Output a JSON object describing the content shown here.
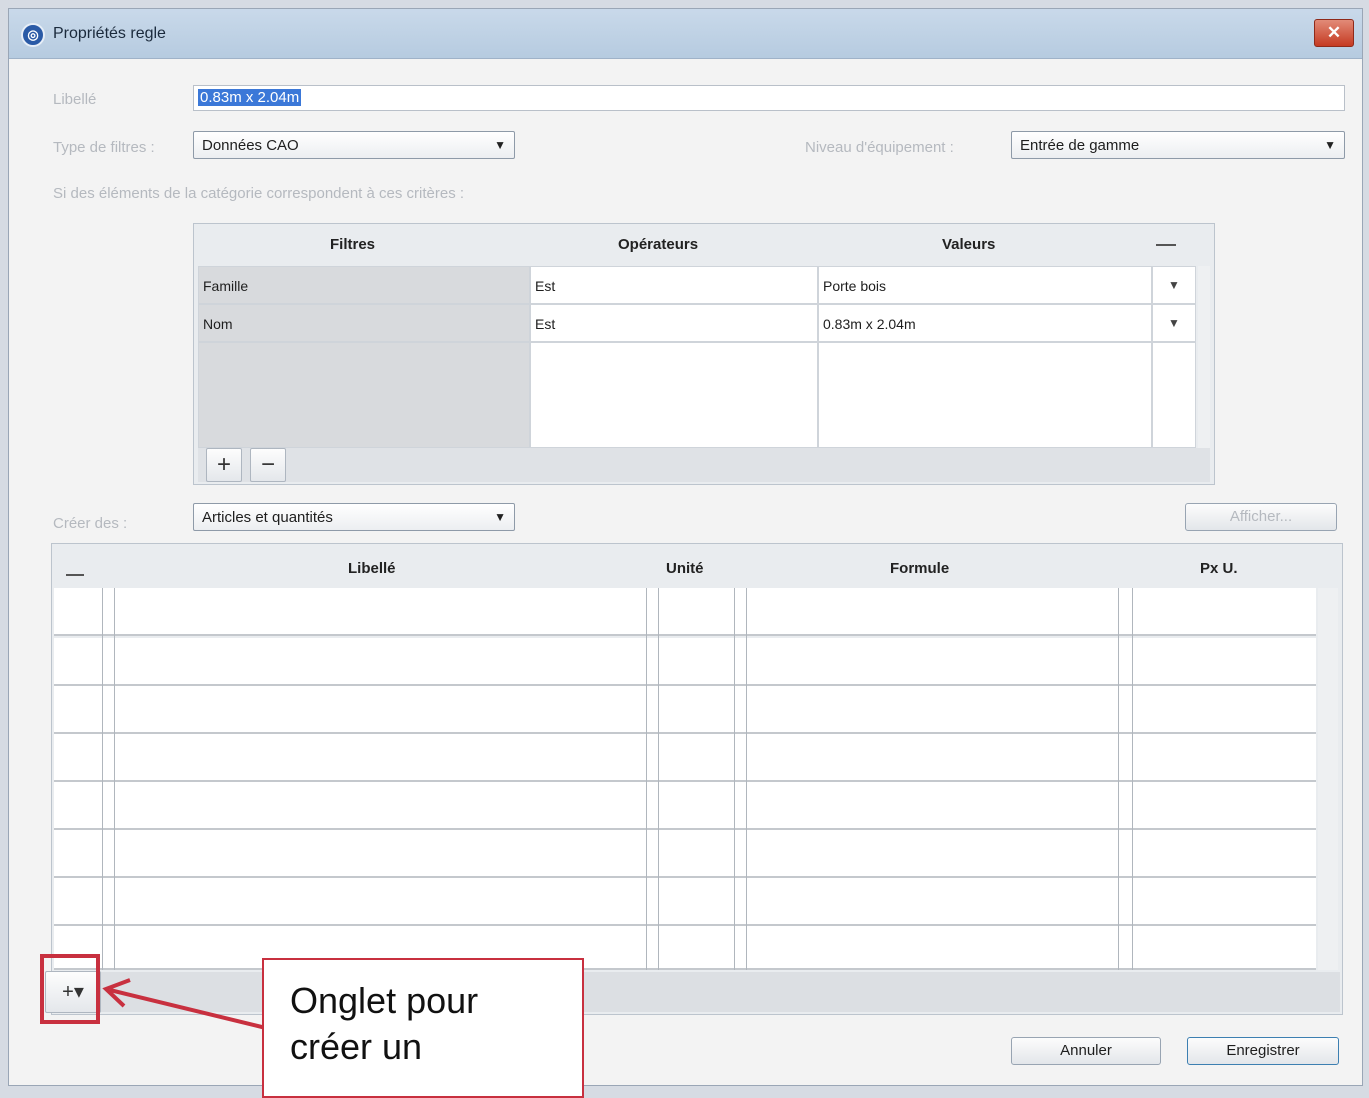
{
  "window": {
    "title": "Propriétés regle"
  },
  "fields": {
    "libelle_label": "Libellé",
    "libelle_value": "0.83m x 2.04m",
    "type_filtres_label": "Type de filtres :",
    "type_filtres_value": "Données CAO",
    "niveau_label": "Niveau d'équipement :",
    "niveau_value": "Entrée de gamme",
    "criteria_text": "Si des éléments de la catégorie correspondent à ces critères :"
  },
  "filter_grid": {
    "columns": [
      "Filtres",
      "Opérateurs",
      "Valeurs"
    ],
    "rows": [
      {
        "filtre": "Famille",
        "operateur": "Est",
        "valeur": "Porte bois"
      },
      {
        "filtre": "Nom",
        "operateur": "Est",
        "valeur": "0.83m x 2.04m"
      }
    ],
    "add_label": "+",
    "remove_label": "−"
  },
  "creer": {
    "label": "Créer des :",
    "value": "Articles et quantités",
    "afficher_label": "Afficher..."
  },
  "article_grid": {
    "columns": [
      "Libellé",
      "Unité",
      "Formule",
      "Px U."
    ],
    "row_count": 8,
    "add_menu_label": "+▾"
  },
  "buttons": {
    "cancel": "Annuler",
    "save": "Enregistrer"
  },
  "callout": {
    "line1": "Onglet pour",
    "line2": "créer un"
  },
  "colors": {
    "callout_red": "#c8303f",
    "selection_blue": "#3b78d8"
  }
}
